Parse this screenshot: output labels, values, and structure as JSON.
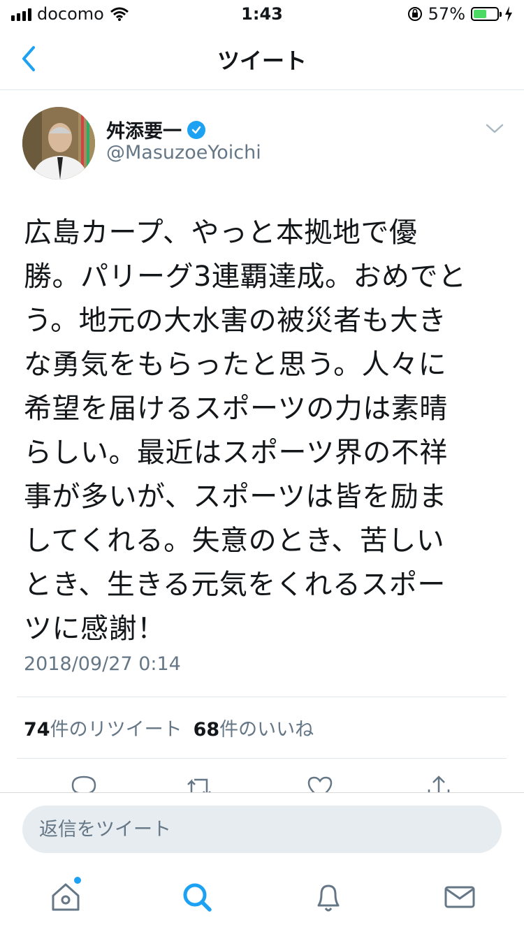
{
  "status_bar": {
    "carrier": "docomo",
    "time": "1:43",
    "battery": "57%",
    "battery_level": 0.57
  },
  "nav": {
    "title": "ツイート"
  },
  "tweet": {
    "author_name": "舛添要一",
    "author_handle": "@MasuzoeYoichi",
    "text": "広島カープ、やっと本拠地で優勝。パリーグ3連覇達成。おめでとう。地元の大水害の被災者も大きな勇気をもらったと思う。人々に希望を届けるスポーツの力は素晴らしい。最近はスポーツ界の不祥事が多いが、スポーツは皆を励ましてくれる。失意のとき、苦しいとき、生きる元気をくれるスポーツに感謝！",
    "text_lines": [
      "広島カープ、やっと本拠地で優",
      "勝。パリーグ3連覇達成。おめでと",
      "う。地元の大水害の被災者も大き",
      "な勇気をもらったと思う。人々に",
      "希望を届けるスポーツの力は素晴",
      "らしい。最近はスポーツ界の不祥",
      "事が多いが、スポーツは皆を励ま",
      "してくれる。失意のとき、苦しい",
      "とき、生きる元気をくれるスポー",
      "ツに感謝！"
    ],
    "timestamp": "2018/09/27 0:14",
    "retweet_count": "74",
    "retweet_label": "件のリツイート",
    "like_count": "68",
    "like_label": "件のいいね"
  },
  "reply": {
    "placeholder": "返信をツイート"
  },
  "icons": {
    "back": "chevron-left-icon",
    "more": "chevron-down-icon",
    "verified": "verified-badge-icon",
    "actions": [
      "reply-icon",
      "retweet-icon",
      "like-icon",
      "share-icon"
    ],
    "tabs": [
      "home-icon",
      "search-icon",
      "notifications-icon",
      "messages-icon"
    ]
  },
  "colors": {
    "accent": "#1da1f2",
    "secondary_text": "#657786",
    "divider": "#e1e8ed",
    "battery": "#4cd964"
  }
}
